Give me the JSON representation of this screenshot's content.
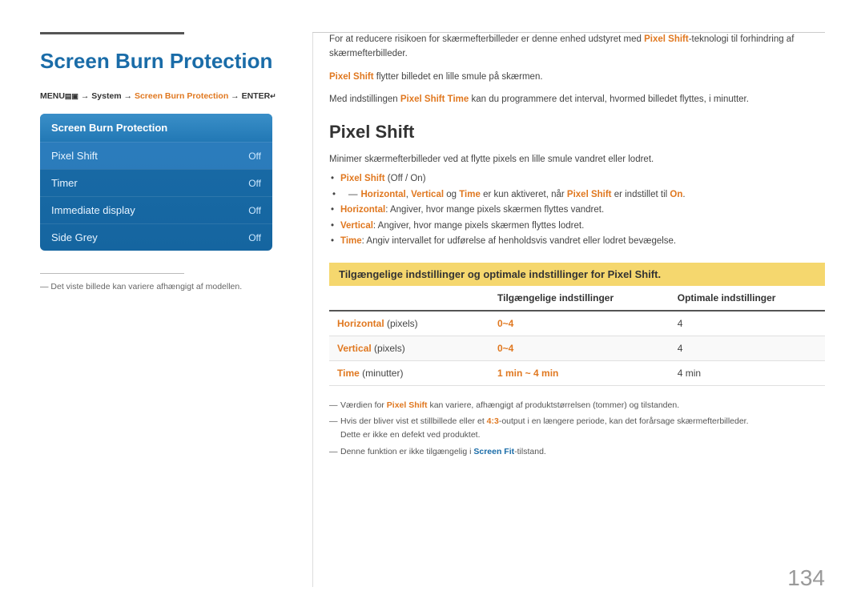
{
  "page": {
    "number": "134"
  },
  "left": {
    "title": "Screen Burn Protection",
    "menu_path_prefix": "MENU",
    "menu_path_middle": " → System → ",
    "menu_path_highlight": "Screen Burn Protection",
    "menu_path_suffix": " → ENTER",
    "panel": {
      "header": "Screen Burn Protection",
      "rows": [
        {
          "label": "Pixel Shift",
          "value": "Off",
          "active": true
        },
        {
          "label": "Timer",
          "value": "Off",
          "active": false
        },
        {
          "label": "Immediate display",
          "value": "Off",
          "active": false
        },
        {
          "label": "Side Grey",
          "value": "Off",
          "active": false
        }
      ]
    },
    "note": "― Det viste billede kan variere afhængigt af modellen."
  },
  "right": {
    "intro_line1_plain": "For at reducere risikoen for skærmefterbilleder er denne enhed udstyret med ",
    "intro_bold1": "Pixel Shift",
    "intro_line1_rest": "-teknologi til forhindring af skærmefterbilleder.",
    "intro_line2_plain": "flytter billedet en lille smule på skærmen.",
    "intro_pixel_shift_label": "Pixel Shift",
    "intro_line3_plain": "Med indstillingen ",
    "intro_bold2": "Pixel Shift Time",
    "intro_line3_rest": " kan du programmere det interval, hvormed billedet flyttes, i minutter.",
    "section_title": "Pixel Shift",
    "body_text": "Minimer skærmefterbilleder ved at flytte pixels en lille smule vandret eller lodret.",
    "bullets": [
      {
        "bold_orange": "Pixel Shift",
        "text": " (Off / On)"
      },
      {
        "sub": "― Horizontal, Vertical og Time er kun aktiveret, når Pixel Shift er indstillet til On."
      },
      {
        "bold_blue": "Horizontal",
        "text": ": Angiver, hvor mange pixels skærmen flyttes vandret."
      },
      {
        "bold_blue": "Vertical",
        "text": ": Angiver, hvor mange pixels skærmen flyttes lodret."
      },
      {
        "bold_blue": "Time",
        "text": ": Angiv intervallet for udførelse af henholdsvis vandret eller lodret bevægelse."
      }
    ],
    "highlight_heading": "Tilgængelige indstillinger og optimale indstillinger for Pixel Shift.",
    "table": {
      "headers": [
        "",
        "Tilgængelige indstillinger",
        "Optimale indstillinger"
      ],
      "rows": [
        {
          "label_bold": "Horizontal",
          "label_rest": " (pixels)",
          "available": "0~4",
          "optimal": "4",
          "alt": false
        },
        {
          "label_bold": "Vertical",
          "label_rest": " (pixels)",
          "available": "0~4",
          "optimal": "4",
          "alt": true
        },
        {
          "label_bold": "Time",
          "label_rest": " (minutter)",
          "available": "1 min ~ 4 min",
          "optimal": "4 min",
          "alt": false
        }
      ]
    },
    "footer_notes": [
      "Værdien for Pixel Shift kan variere, afhængigt af produktstørrelsen (tommer) og tilstanden.",
      "Hvis der bliver vist et stillbillede eller et 4:3-output i en længere periode, kan det forårsage skærmefterbilleder. Dette er ikke en defekt ved produktet.",
      "Denne funktion er ikke tilgængelig i Screen Fit-tilstand."
    ]
  }
}
